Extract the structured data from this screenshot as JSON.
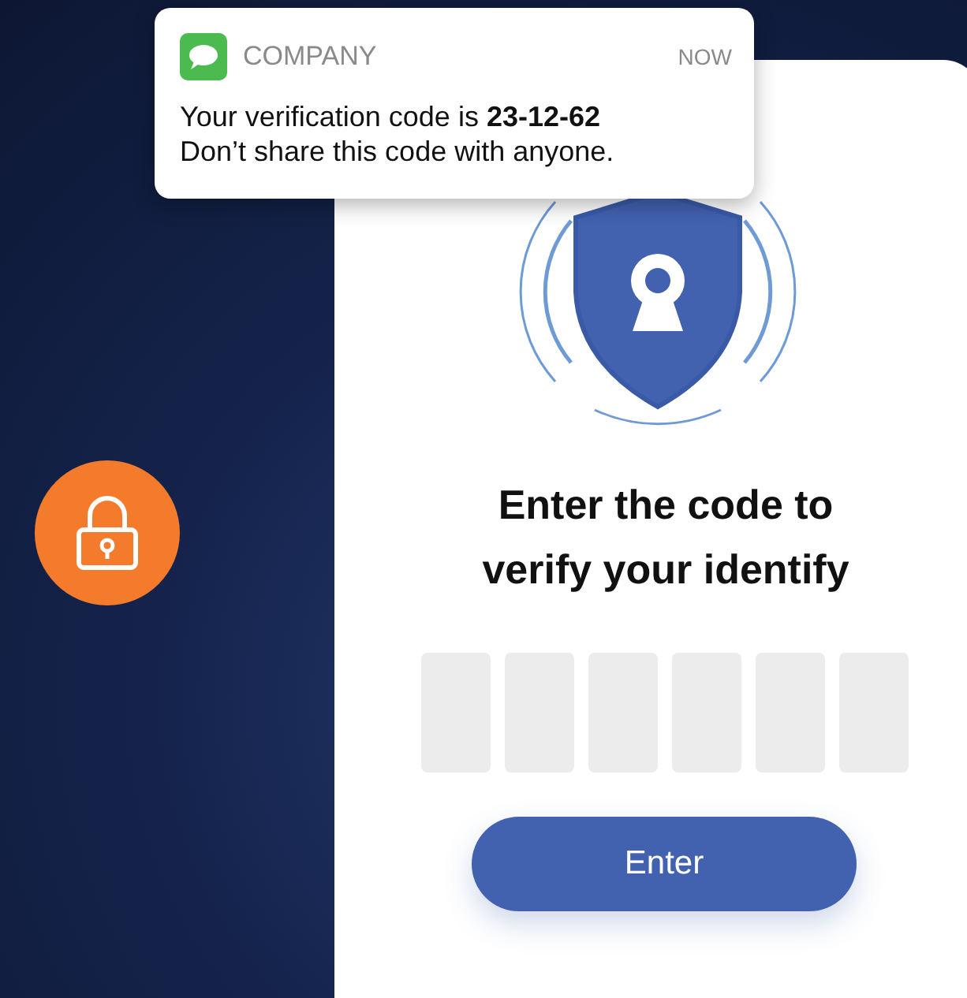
{
  "notification": {
    "app": "COMPANY",
    "time": "NOW",
    "message": "Your verification code is **23-12-62**",
    "note": "Don’t share this code with anyone."
  },
  "verify": {
    "heading": "Enter the code to verify your identify",
    "code_fields": [
      {
        "filled": false
      },
      {
        "filled": false
      },
      {
        "filled": false
      },
      {
        "filled": false
      },
      {
        "filled": false
      },
      {
        "filled": false
      }
    ],
    "button": "Enter"
  }
}
